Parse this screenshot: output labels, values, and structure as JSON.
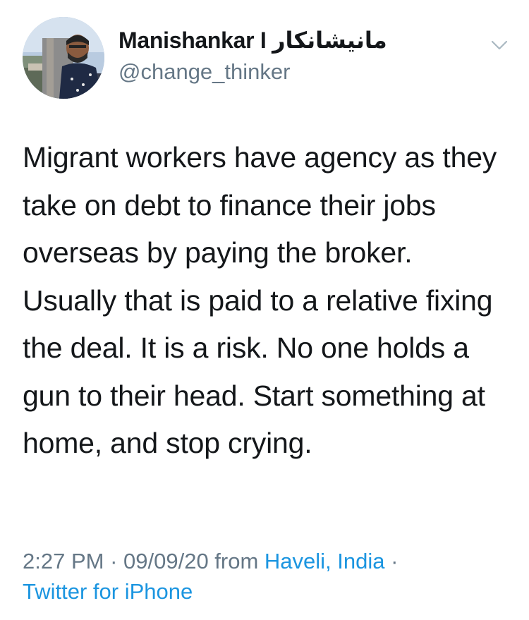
{
  "user": {
    "display_name": "Manishankar I مانیشانکار",
    "handle": "@change_thinker"
  },
  "tweet": {
    "text": "Migrant workers have agency as they take on debt to finance their jobs overseas by paying the broker. Usually that is paid to a relative fixing the deal. It is a risk. No one holds a gun to their head. Start something at home, and stop crying."
  },
  "meta": {
    "time": "2:27 PM",
    "separator1": " · ",
    "date": "09/09/20",
    "from_label": " from ",
    "location": "Haveli, India",
    "separator2": " · ",
    "source": "Twitter for iPhone"
  },
  "icons": {
    "avatar": "profile-photo",
    "caret": "chevron-down-icon"
  },
  "colors": {
    "text": "#14171a",
    "secondary": "#657786",
    "link": "#1b95e0",
    "caret": "#aab8c2"
  }
}
